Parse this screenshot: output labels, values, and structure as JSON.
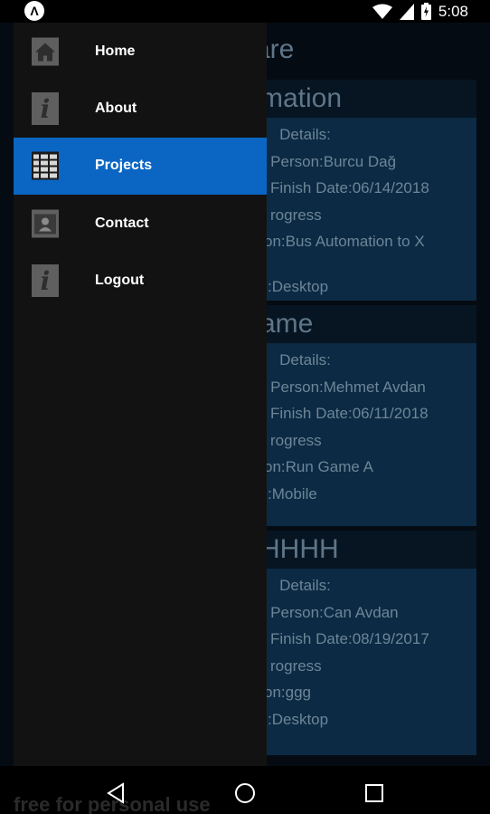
{
  "status_bar": {
    "app_icon_glyph": "Λ",
    "time": "5:08"
  },
  "app": {
    "title_fragment": "are",
    "projects": [
      {
        "title": "mation",
        "lines": [
          "Details:",
          "g Person:Burcu Dağ",
          "Finish Date:06/14/2018",
          "rogress",
          "on:Bus Automation to X",
          ":Desktop"
        ]
      },
      {
        "title": "ame",
        "lines": [
          "Details:",
          "g Person:Mehmet Avdan",
          "Finish Date:06/11/2018",
          "rogress",
          "on:Run Game A",
          ":Mobile"
        ]
      },
      {
        "title": "HHHH",
        "lines": [
          "Details:",
          "g Person:Can Avdan",
          "Finish Date:08/19/2017",
          "rogress",
          "on:ggg",
          ":Desktop"
        ]
      }
    ]
  },
  "drawer": {
    "items": [
      {
        "label": "Home",
        "icon": "home-icon",
        "active": false
      },
      {
        "label": "About",
        "icon": "info-icon",
        "active": false
      },
      {
        "label": "Projects",
        "icon": "grid-icon",
        "active": true
      },
      {
        "label": "Contact",
        "icon": "contact-card-icon",
        "active": false
      },
      {
        "label": "Logout",
        "icon": "info-icon",
        "active": false
      }
    ]
  },
  "watermark": "free for personal use",
  "colors": {
    "active_item": "#0b66c3",
    "drawer_bg": "#121212",
    "card_bg": "#0c2a44"
  }
}
